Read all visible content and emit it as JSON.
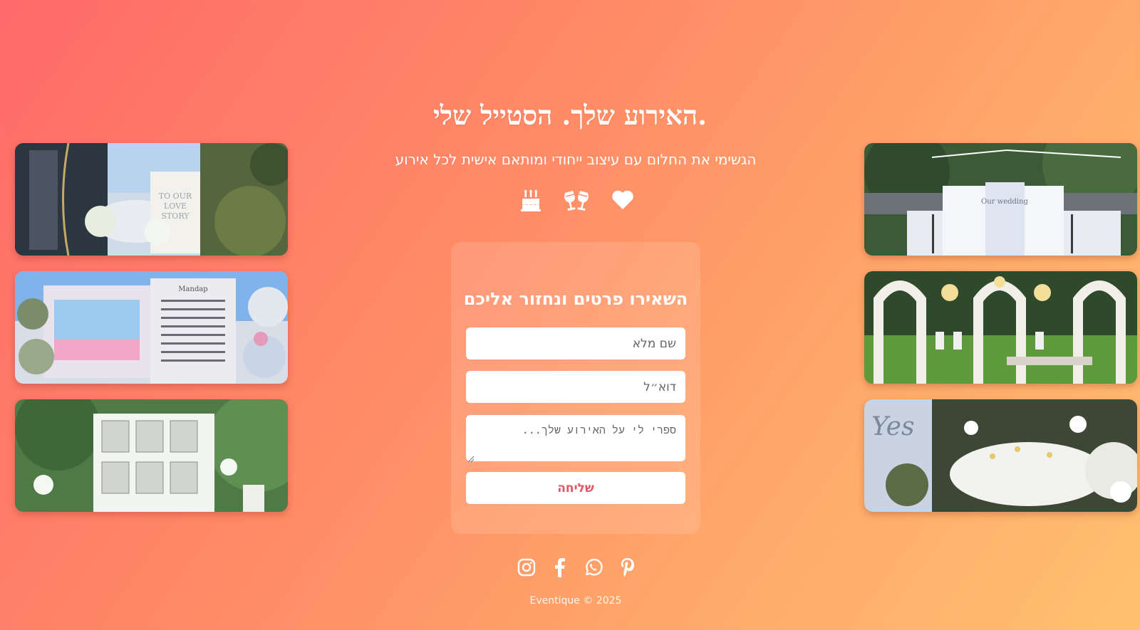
{
  "hero": {
    "title": "האירוע שלך. הסטייל שלי.",
    "subtitle": "הגשימי את החלום עם עיצוב ייחודי ומותאם אישית לכל אירוע",
    "feature_icons": [
      "cake-icon",
      "champagne-glasses-icon",
      "heart-icon"
    ]
  },
  "gallery_left": [
    {
      "name": "wedding-welcome-sign-photo",
      "sign_text": "TO OUR LOVE STORY"
    },
    {
      "name": "mandap-book-decor-photo",
      "sign_text": "Mandap"
    },
    {
      "name": "garden-photo-frames-photo",
      "sign_text": ""
    }
  ],
  "gallery_right": [
    {
      "name": "flower-wall-stage-photo",
      "sign_text": "Our wedding"
    },
    {
      "name": "arches-chandeliers-lawn-photo",
      "sign_text": ""
    },
    {
      "name": "yes-sign-tables-photo",
      "sign_text": "Yes"
    }
  ],
  "form": {
    "title": "השאירו פרטים ונחזור אליכם",
    "name_placeholder": "שם מלא",
    "email_placeholder": "דוא״ל",
    "message_placeholder": "ספרי לי על האירוע שלך...",
    "submit_label": "שליחה"
  },
  "social": [
    "instagram-icon",
    "facebook-icon",
    "whatsapp-icon",
    "pinterest-icon"
  ],
  "footer": {
    "copyright": "Eventique © 2025"
  },
  "colors": {
    "gradient_start": "#ff6a6a",
    "gradient_end": "#ffc070",
    "submit_text": "#e25563",
    "text": "#ffffff"
  }
}
